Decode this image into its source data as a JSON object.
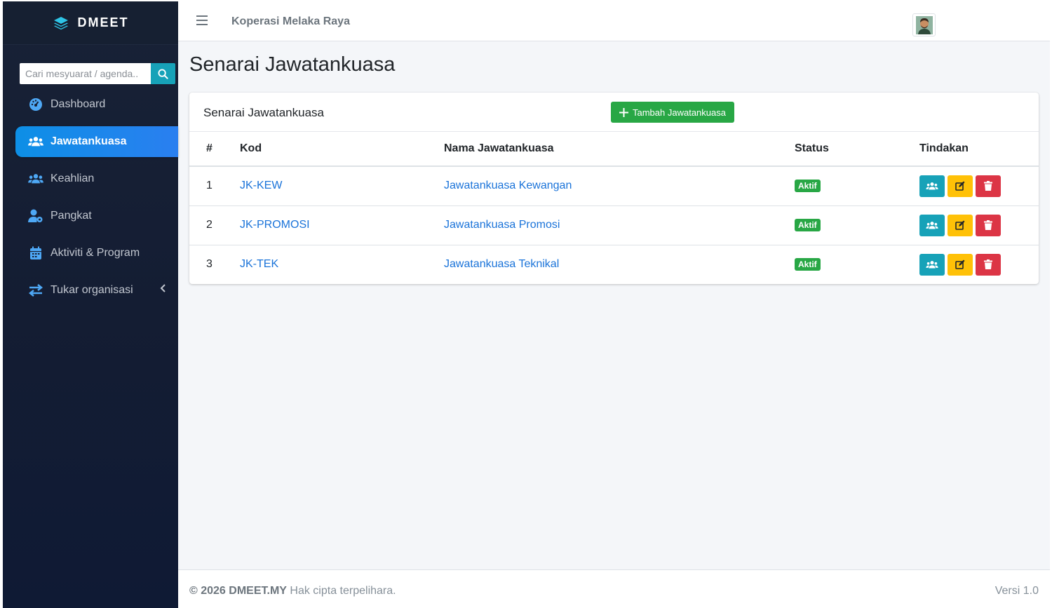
{
  "brand": {
    "name": "DMEET",
    "icon": "layers-icon"
  },
  "search": {
    "placeholder": "Cari mesyuarat / agenda..",
    "icon": "search-icon"
  },
  "sidebar": {
    "items": [
      {
        "label": "Dashboard",
        "icon": "tachometer-icon",
        "active": false
      },
      {
        "label": "Jawatankuasa",
        "icon": "users-icon",
        "active": true
      },
      {
        "label": "Keahlian",
        "icon": "users-icon",
        "active": false
      },
      {
        "label": "Pangkat",
        "icon": "user-cog-icon",
        "active": false
      },
      {
        "label": "Aktiviti & Program",
        "icon": "calendar-icon",
        "active": false
      },
      {
        "label": "Tukar organisasi",
        "icon": "exchange-icon",
        "active": false,
        "has_submenu": true
      }
    ]
  },
  "topbar": {
    "organization": "Koperasi Melaka Raya",
    "menu_icon": "hamburger-icon",
    "avatar": "avatar"
  },
  "page": {
    "title": "Senarai Jawatankuasa"
  },
  "card": {
    "title": "Senarai Jawatankuasa",
    "add_button": "Tambah Jawatankuasa"
  },
  "table": {
    "headers": [
      "#",
      "Kod",
      "Nama Jawatankuasa",
      "Status",
      "Tindakan"
    ],
    "rows": [
      {
        "no": "1",
        "kod": "JK-KEW",
        "nama": "Jawatankuasa Kewangan",
        "status": "Aktif"
      },
      {
        "no": "2",
        "kod": "JK-PROMOSI",
        "nama": "Jawatankuasa Promosi",
        "status": "Aktif"
      },
      {
        "no": "3",
        "kod": "JK-TEK",
        "nama": "Jawatankuasa Teknikal",
        "status": "Aktif"
      }
    ]
  },
  "footer": {
    "copyright": "© 2026 DMEET.MY",
    "rights": "Hak cipta terpelihara.",
    "version": "Versi 1.0"
  },
  "colors": {
    "primary": "#1a73d9",
    "success": "#28a745",
    "info": "#17a2b8",
    "warning": "#ffc107",
    "danger": "#dc3545",
    "sidebar": "#141d33"
  }
}
